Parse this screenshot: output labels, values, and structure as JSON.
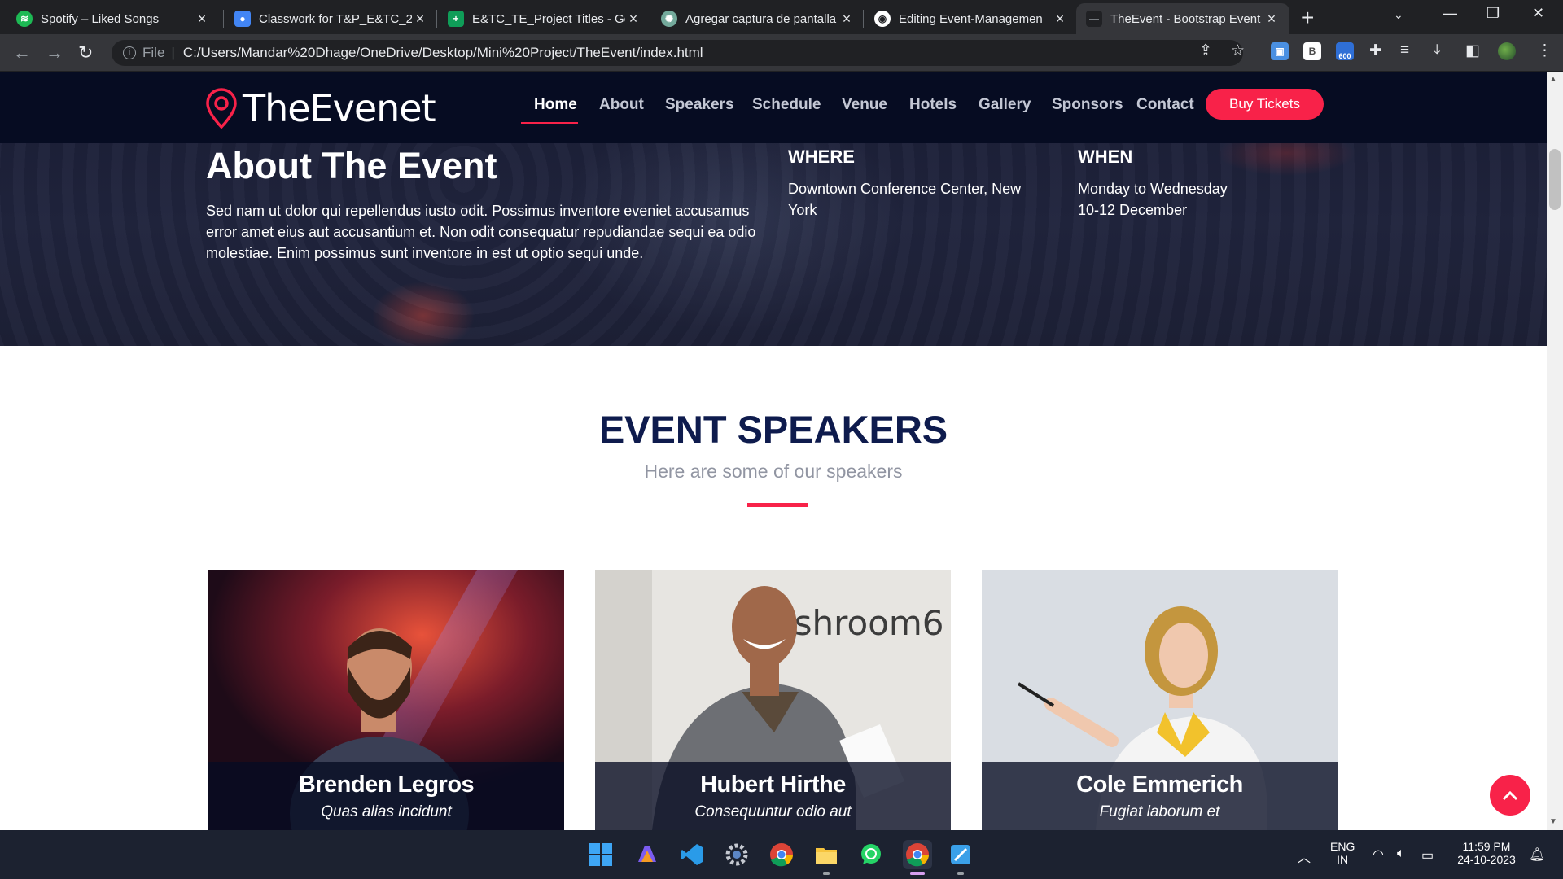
{
  "browser": {
    "tabs": [
      {
        "title": "Spotify – Liked Songs",
        "icon": "spotify-icon",
        "color": "#1db954"
      },
      {
        "title": "Classwork for T&P_E&TC_2",
        "icon": "classroom-icon",
        "color": "#4285f4"
      },
      {
        "title": "E&TC_TE_Project Titles - Go",
        "icon": "sheets-icon",
        "color": "#0f9d58"
      },
      {
        "title": "Agregar captura de pantalla",
        "icon": "chatgpt-icon",
        "color": "#74aa9c"
      },
      {
        "title": "Editing Event-Managemen",
        "icon": "github-icon",
        "color": "#ffffff"
      },
      {
        "title": "TheEvent - Bootstrap Event",
        "icon": "page-icon",
        "color": "#3c4043"
      }
    ],
    "address": {
      "scheme_label": "File",
      "url": "C:/Users/Mandar%20Dhage/OneDrive/Desktop/Mini%20Project/TheEvent/index.html"
    },
    "extension_badge": "600"
  },
  "site": {
    "logo_text": "TheEvenet",
    "nav": [
      "Home",
      "About",
      "Speakers",
      "Schedule",
      "Venue",
      "Hotels",
      "Gallery",
      "Sponsors",
      "Contact"
    ],
    "buy_label": "Buy Tickets",
    "accent": "#f82249",
    "navy": "#060c22"
  },
  "about": {
    "title": "About The Event",
    "text": "Sed nam ut dolor qui repellendus iusto odit. Possimus inventore eveniet accusamus error amet eius aut accusantium et. Non odit consequatur repudiandae sequi ea odio molestiae. Enim possimus sunt inventore in est ut optio sequi unde.",
    "where_label": "WHERE",
    "where_text": "Downtown Conference Center, New York",
    "when_label": "WHEN",
    "when_line1": "Monday to Wednesday",
    "when_line2": "10-12 December"
  },
  "speakers": {
    "title": "EVENT SPEAKERS",
    "subtitle": "Here are some of our speakers",
    "people": [
      {
        "name": "Brenden Legros",
        "role": "Quas alias incidunt"
      },
      {
        "name": "Hubert Hirthe",
        "role": "Consequuntur odio aut",
        "wall_text": "mashroom6"
      },
      {
        "name": "Cole Emmerich",
        "role": "Fugiat laborum et"
      }
    ]
  },
  "taskbar": {
    "language": "ENG",
    "region": "IN",
    "time": "11:59 PM",
    "date": "24-10-2023",
    "apps": [
      "windows-start-icon",
      "copilot-pre-icon",
      "vscode-icon",
      "settings-icon",
      "chrome-icon",
      "file-explorer-icon",
      "whatsapp-icon",
      "chrome-active-icon",
      "snipping-tool-icon"
    ]
  }
}
